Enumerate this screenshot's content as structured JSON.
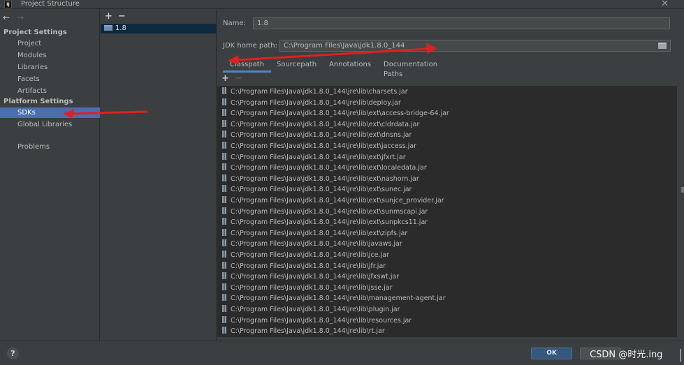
{
  "window": {
    "title": "Project Structure",
    "logo": "IJ",
    "close_icon": "close-icon"
  },
  "left_nav": {
    "back_icon": "←",
    "forward_icon": "→",
    "project_settings_header": "Project Settings",
    "project_items": [
      "Project",
      "Modules",
      "Libraries",
      "Facets",
      "Artifacts"
    ],
    "platform_settings_header": "Platform Settings",
    "platform_items": [
      "SDKs",
      "Global Libraries"
    ],
    "problems": "Problems",
    "selected": "SDKs"
  },
  "sdk_list": {
    "add_icon": "+",
    "remove_icon": "−",
    "items": [
      "1.8"
    ]
  },
  "sdk_detail": {
    "name_label": "Name:",
    "name_value": "1.8",
    "home_label": "JDK home path:",
    "home_value": "C:\\Program Files\\Java\\jdk1.8.0_144",
    "tabs": [
      "Classpath",
      "Sourcepath",
      "Annotations",
      "Documentation Paths"
    ],
    "active_tab": "Classpath",
    "add_icon": "+",
    "remove_icon": "−",
    "classpath": [
      "C:\\Program Files\\Java\\jdk1.8.0_144\\jre\\lib\\charsets.jar",
      "C:\\Program Files\\Java\\jdk1.8.0_144\\jre\\lib\\deploy.jar",
      "C:\\Program Files\\Java\\jdk1.8.0_144\\jre\\lib\\ext\\access-bridge-64.jar",
      "C:\\Program Files\\Java\\jdk1.8.0_144\\jre\\lib\\ext\\cldrdata.jar",
      "C:\\Program Files\\Java\\jdk1.8.0_144\\jre\\lib\\ext\\dnsns.jar",
      "C:\\Program Files\\Java\\jdk1.8.0_144\\jre\\lib\\ext\\jaccess.jar",
      "C:\\Program Files\\Java\\jdk1.8.0_144\\jre\\lib\\ext\\jfxrt.jar",
      "C:\\Program Files\\Java\\jdk1.8.0_144\\jre\\lib\\ext\\localedata.jar",
      "C:\\Program Files\\Java\\jdk1.8.0_144\\jre\\lib\\ext\\nashorn.jar",
      "C:\\Program Files\\Java\\jdk1.8.0_144\\jre\\lib\\ext\\sunec.jar",
      "C:\\Program Files\\Java\\jdk1.8.0_144\\jre\\lib\\ext\\sunjce_provider.jar",
      "C:\\Program Files\\Java\\jdk1.8.0_144\\jre\\lib\\ext\\sunmscapi.jar",
      "C:\\Program Files\\Java\\jdk1.8.0_144\\jre\\lib\\ext\\sunpkcs11.jar",
      "C:\\Program Files\\Java\\jdk1.8.0_144\\jre\\lib\\ext\\zipfs.jar",
      "C:\\Program Files\\Java\\jdk1.8.0_144\\jre\\lib\\javaws.jar",
      "C:\\Program Files\\Java\\jdk1.8.0_144\\jre\\lib\\jce.jar",
      "C:\\Program Files\\Java\\jdk1.8.0_144\\jre\\lib\\jfr.jar",
      "C:\\Program Files\\Java\\jdk1.8.0_144\\jre\\lib\\jfxswt.jar",
      "C:\\Program Files\\Java\\jdk1.8.0_144\\jre\\lib\\jsse.jar",
      "C:\\Program Files\\Java\\jdk1.8.0_144\\jre\\lib\\management-agent.jar",
      "C:\\Program Files\\Java\\jdk1.8.0_144\\jre\\lib\\plugin.jar",
      "C:\\Program Files\\Java\\jdk1.8.0_144\\jre\\lib\\resources.jar",
      "C:\\Program Files\\Java\\jdk1.8.0_144\\jre\\lib\\rt.jar"
    ]
  },
  "footer": {
    "help_label": "?",
    "ok_label": "OK",
    "watermark": "CSDN @时光.ing"
  },
  "colors": {
    "accent": "#4b6eaf",
    "annotation_arrow": "#e02020",
    "ok_button": "#365880"
  }
}
